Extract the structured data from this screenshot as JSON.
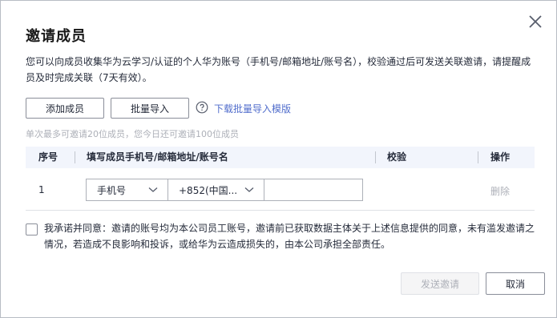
{
  "dialog": {
    "title": "邀请成员",
    "description": "您可以向成员收集华为云学习/认证的个人华为账号（手机号/邮箱地址/账号名），校验通过后可发送关联邀请，请提醒成员及时完成关联（7天有效）。"
  },
  "toolbar": {
    "add_label": "添加成员",
    "batch_label": "批量导入",
    "download_link": "下载批量导入模版"
  },
  "hint": "单次最多可邀请20位成员，您今日还可邀请100位成员",
  "table": {
    "headers": {
      "index": "序号",
      "account": "填写成员手机号/邮箱地址/账号名",
      "verify": "校验",
      "action": "操作"
    },
    "rows": [
      {
        "index": "1",
        "type": "手机号",
        "country_code": "+852(中国...",
        "value": "",
        "action": "删除"
      }
    ]
  },
  "agreement": "我承诺并同意：邀请的账号均为本公司员工账号，邀请前已获取数据主体关于上述信息提供的同意，未有滥发邀请之情况，若造成不良影响和投诉，或给华为云造成损失的，由本公司承担全部责任。",
  "footer": {
    "send_label": "发送邀请",
    "cancel_label": "取消"
  }
}
